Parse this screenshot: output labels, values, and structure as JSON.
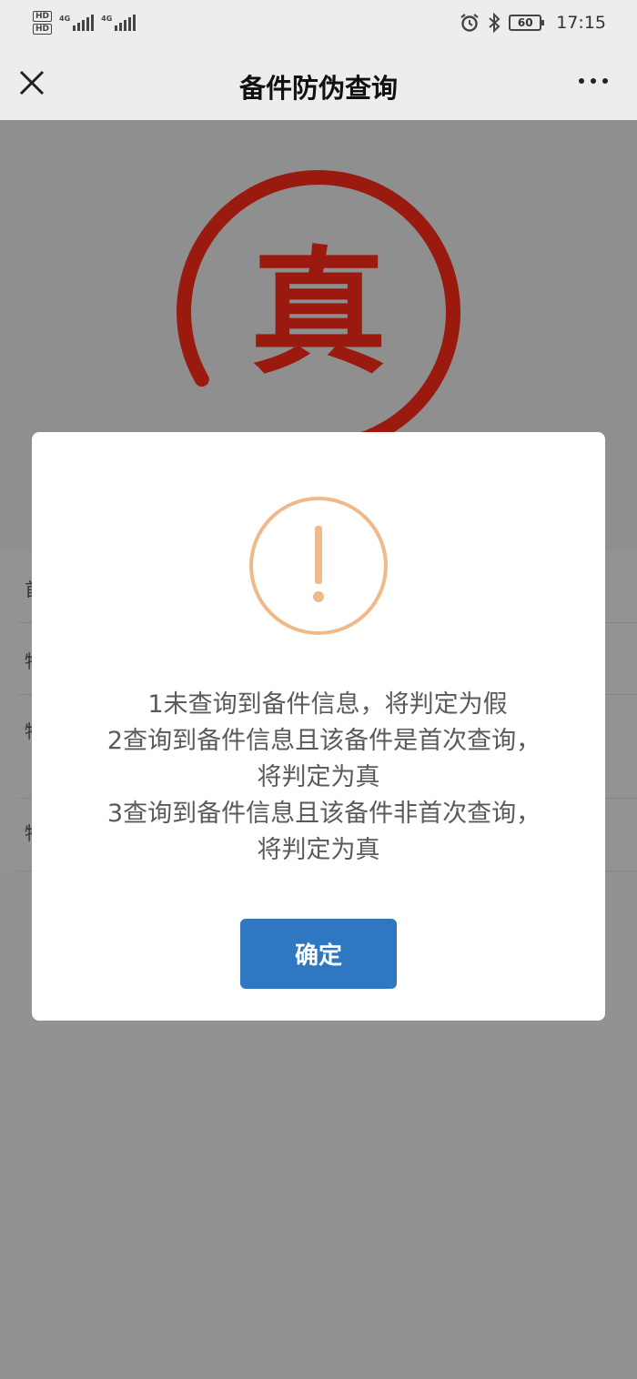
{
  "status_bar": {
    "sim1": "HD",
    "sim2": "HD",
    "net1": "4G",
    "net2": "4G",
    "battery": "60",
    "time": "17:15",
    "icons": [
      "alarm-icon",
      "bluetooth-icon",
      "battery-icon"
    ]
  },
  "header": {
    "title": "备件防伪查询",
    "close_icon": "close-icon",
    "more_icon": "more-icon"
  },
  "background": {
    "stamp_text": "真",
    "stamp_color": "#9b1a0f",
    "rows": [
      "首",
      "物",
      "物",
      "物"
    ]
  },
  "dialog": {
    "icon": "exclamation-icon",
    "icon_color": "#f0b98a",
    "lines": [
      "1未查询到备件信息，将判定为假",
      "2查询到备件信息且该备件是首次查询，",
      "将判定为真",
      "3查询到备件信息且该备件非首次查询，",
      "将判定为真"
    ],
    "confirm_label": "确定",
    "confirm_color": "#2f77c1"
  }
}
